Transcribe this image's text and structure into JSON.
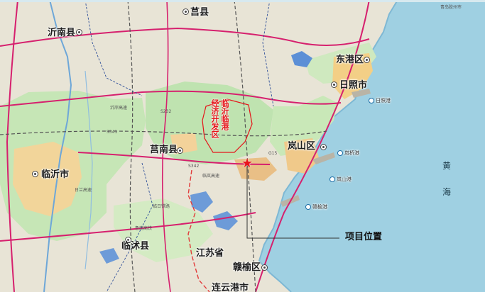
{
  "colors": {
    "sea": "#9fd0e2",
    "land": "#e8e4d6",
    "green_zone": "#bfe3b0",
    "urban": "#f2cf8e",
    "highway": "#d6206e",
    "boundary": "#2f4f9a",
    "project_star": "#e8151b"
  },
  "map": {
    "cities": [
      {
        "id": "junan",
        "label": "莒县"
      },
      {
        "id": "yinan",
        "label": "沂南县"
      },
      {
        "id": "donggang",
        "label": "东港区"
      },
      {
        "id": "rizhao",
        "label": "日照市"
      },
      {
        "id": "lanshan",
        "label": "岚山区"
      },
      {
        "id": "junanxian",
        "label": "莒南县"
      },
      {
        "id": "linyi",
        "label": "临沂市"
      },
      {
        "id": "linshu",
        "label": "临沭县"
      },
      {
        "id": "jiangsu",
        "label": "江苏省"
      },
      {
        "id": "ganyu",
        "label": "赣榆区"
      },
      {
        "id": "lianyungang",
        "label": "连云港市"
      }
    ],
    "zone_label": [
      "临沂临港",
      "经济开发区"
    ],
    "project_callout": "项目位置",
    "sea_label": [
      "黄",
      "海"
    ],
    "ports": [
      {
        "id": "rizhao-port",
        "label": "日照港"
      },
      {
        "id": "lanshan-port",
        "label": "岚山港"
      },
      {
        "id": "ganyu-port",
        "label": "赣榆港"
      },
      {
        "id": "lanqiao-port",
        "label": "岚桥港"
      }
    ],
    "minor_labels": {
      "city_top_right": "青岛胶州市",
      "s341": "S341",
      "s232": "S232",
      "s342": "S342",
      "g15": "G15",
      "linlan": "临岚高速",
      "rilan": "日兰高速",
      "linrao": "临日铁路",
      "yigan": "沂岸高速",
      "lunan": "鲁南高铁"
    }
  }
}
